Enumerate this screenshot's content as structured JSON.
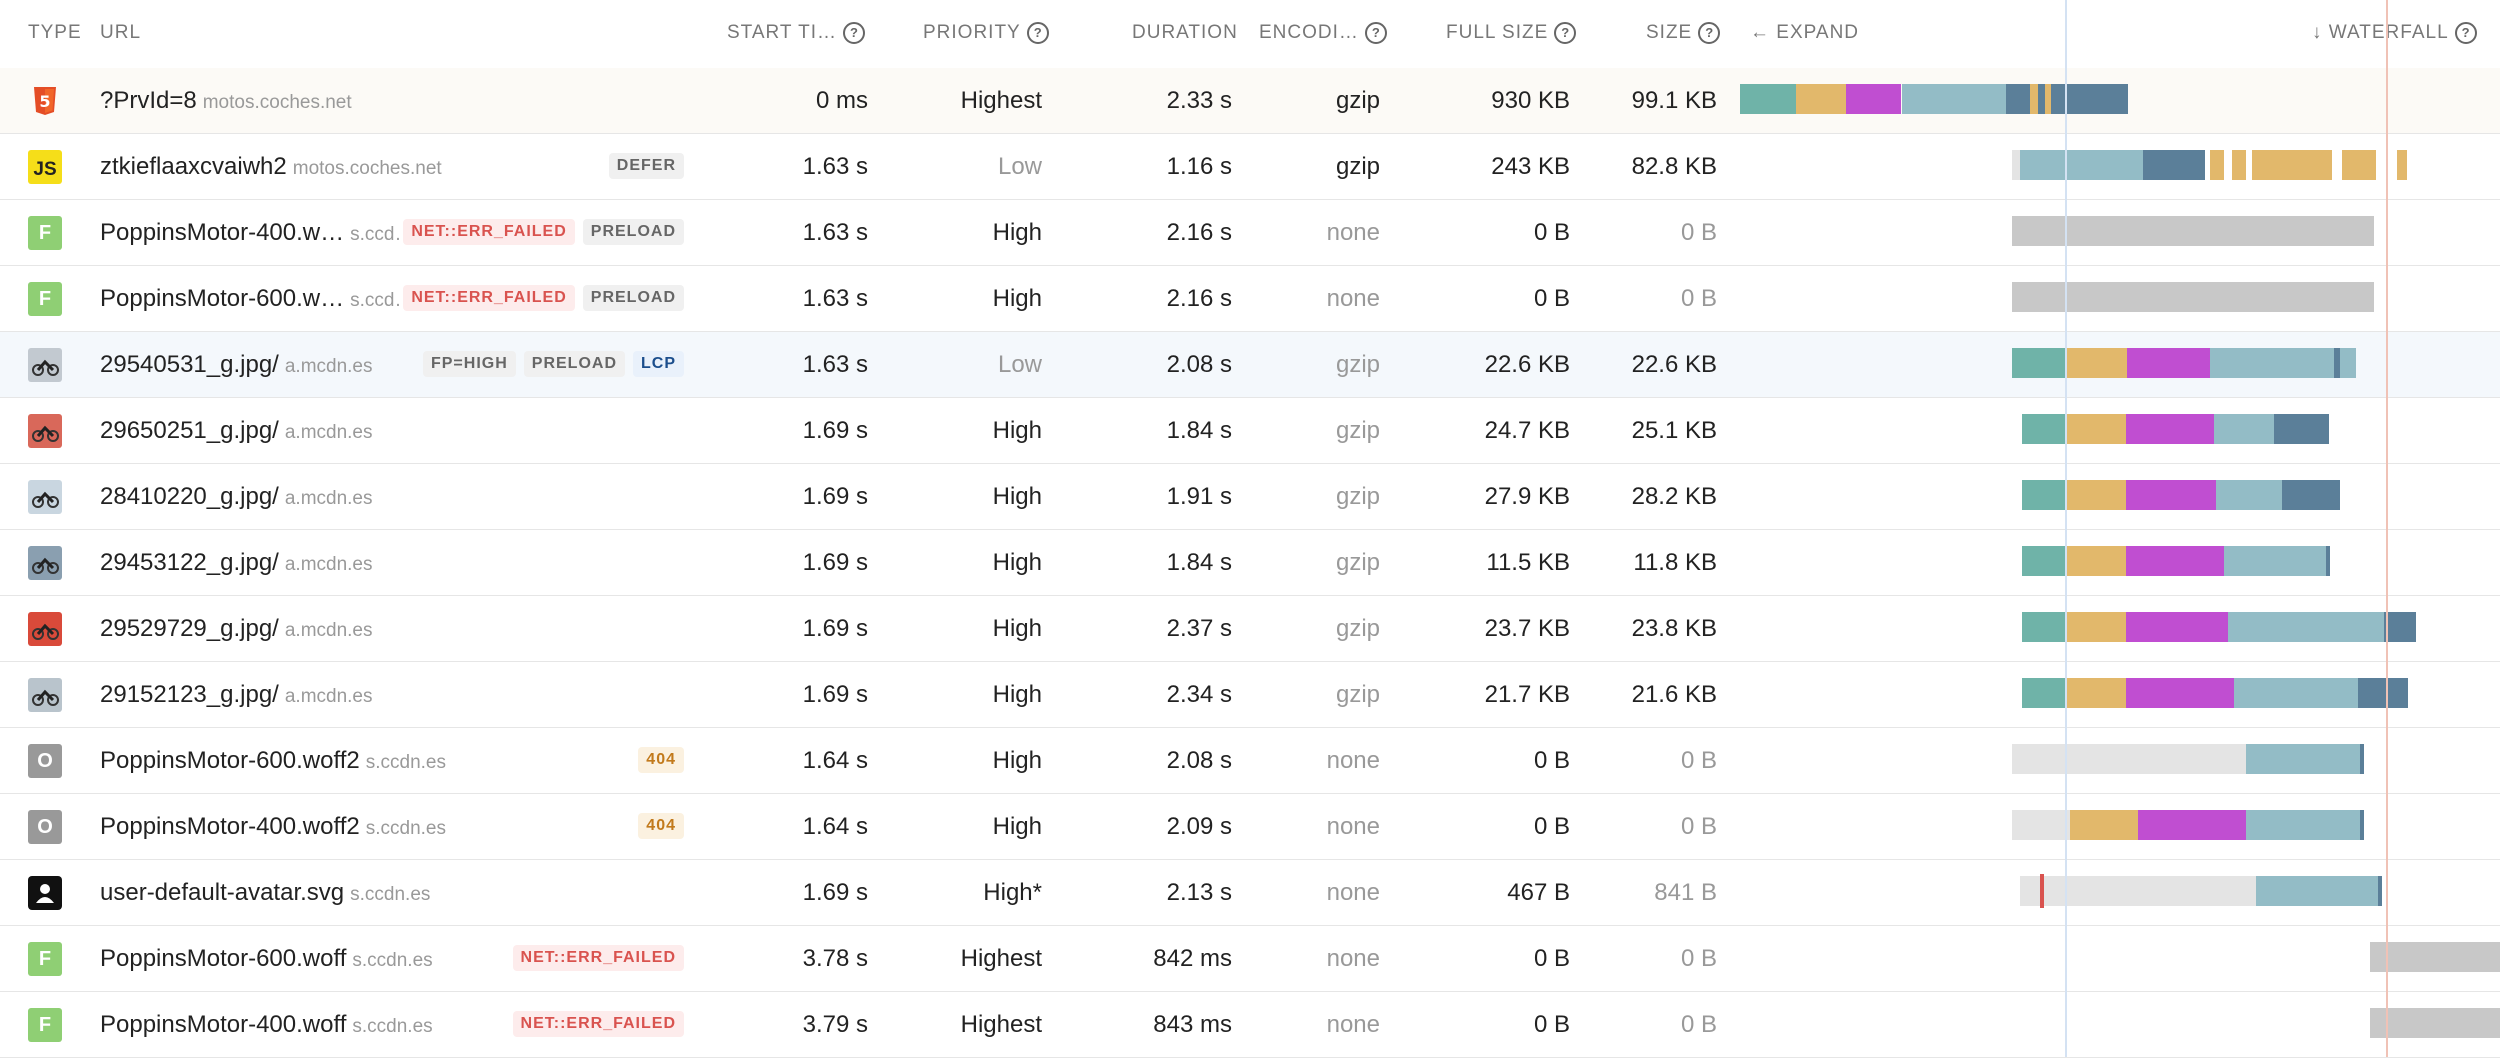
{
  "header": {
    "type": "TYPE",
    "url": "URL",
    "start_time": "START TI…",
    "priority": "PRIORITY",
    "duration": "DURATION",
    "encoding": "ENCODI…",
    "full_size": "FULL SIZE",
    "size": "SIZE",
    "expand": "EXPAND",
    "expand_arrow": "←",
    "waterfall": "WATERFALL",
    "waterfall_arrow": "↓",
    "help_glyph": "?"
  },
  "colors": {
    "teal_wait": "#6fb3a8",
    "orange_connect": "#e2b86b",
    "purple_ssl": "#c04ed1",
    "blue_download": "#93bcc6",
    "dark_blue": "#5b7f99",
    "grey_failed": "#c8c8c8",
    "light_grey_queue": "#e4e4e4",
    "lcp_line": "#e07a5f",
    "fcp_line": "#a9c4e8"
  },
  "rows": [
    {
      "type_icon": "html5-icon",
      "type_glyph": "5",
      "url": "?PrvId=8",
      "domain": "motos.coches.net",
      "badges": [],
      "start": "0 ms",
      "priority": "Highest",
      "priority_muted": false,
      "duration": "2.33 s",
      "encoding": "gzip",
      "encoding_muted": false,
      "full_size": "930 KB",
      "size": "99.1 KB",
      "size_muted": false
    },
    {
      "type_icon": "javascript-icon",
      "type_glyph": "JS",
      "url": "ztkieflaaxcvaiwh2",
      "domain": "motos.coches.net",
      "badges": [
        {
          "text": "DEFER",
          "kind": "plain"
        }
      ],
      "start": "1.63 s",
      "priority": "Low",
      "priority_muted": true,
      "duration": "1.16 s",
      "encoding": "gzip",
      "encoding_muted": false,
      "full_size": "243 KB",
      "size": "82.8 KB",
      "size_muted": false
    },
    {
      "type_icon": "font-icon",
      "type_glyph": "F",
      "url": "PoppinsMotor-400.w…",
      "domain": "s.ccd…",
      "badges": [
        {
          "text": "NET::ERR_FAILED",
          "kind": "err"
        },
        {
          "text": "PRELOAD",
          "kind": "plain"
        }
      ],
      "start": "1.63 s",
      "priority": "High",
      "priority_muted": false,
      "duration": "2.16 s",
      "encoding": "none",
      "encoding_muted": true,
      "full_size": "0 B",
      "size": "0 B",
      "size_muted": true
    },
    {
      "type_icon": "font-icon",
      "type_glyph": "F",
      "url": "PoppinsMotor-600.w…",
      "domain": "s.ccd…",
      "badges": [
        {
          "text": "NET::ERR_FAILED",
          "kind": "err"
        },
        {
          "text": "PRELOAD",
          "kind": "plain"
        }
      ],
      "start": "1.63 s",
      "priority": "High",
      "priority_muted": false,
      "duration": "2.16 s",
      "encoding": "none",
      "encoding_muted": true,
      "full_size": "0 B",
      "size": "0 B",
      "size_muted": true
    },
    {
      "type_icon": "image-thumbnail-icon",
      "type_glyph": "",
      "url": "29540531_g.jpg/",
      "domain": "a.mcdn.es",
      "badges": [
        {
          "text": "FP=HIGH",
          "kind": "plain"
        },
        {
          "text": "PRELOAD",
          "kind": "plain"
        },
        {
          "text": "LCP",
          "kind": "lcp"
        }
      ],
      "start": "1.63 s",
      "priority": "Low",
      "priority_muted": true,
      "duration": "2.08 s",
      "encoding": "gzip",
      "encoding_muted": true,
      "full_size": "22.6 KB",
      "size": "22.6 KB",
      "size_muted": false
    },
    {
      "type_icon": "image-thumbnail-icon",
      "type_glyph": "",
      "url": "29650251_g.jpg/",
      "domain": "a.mcdn.es",
      "badges": [],
      "start": "1.69 s",
      "priority": "High",
      "priority_muted": false,
      "duration": "1.84 s",
      "encoding": "gzip",
      "encoding_muted": true,
      "full_size": "24.7 KB",
      "size": "25.1 KB",
      "size_muted": false
    },
    {
      "type_icon": "image-thumbnail-icon",
      "type_glyph": "",
      "url": "28410220_g.jpg/",
      "domain": "a.mcdn.es",
      "badges": [],
      "start": "1.69 s",
      "priority": "High",
      "priority_muted": false,
      "duration": "1.91 s",
      "encoding": "gzip",
      "encoding_muted": true,
      "full_size": "27.9 KB",
      "size": "28.2 KB",
      "size_muted": false
    },
    {
      "type_icon": "image-thumbnail-icon",
      "type_glyph": "",
      "url": "29453122_g.jpg/",
      "domain": "a.mcdn.es",
      "badges": [],
      "start": "1.69 s",
      "priority": "High",
      "priority_muted": false,
      "duration": "1.84 s",
      "encoding": "gzip",
      "encoding_muted": true,
      "full_size": "11.5 KB",
      "size": "11.8 KB",
      "size_muted": false
    },
    {
      "type_icon": "image-thumbnail-icon",
      "type_glyph": "",
      "url": "29529729_g.jpg/",
      "domain": "a.mcdn.es",
      "badges": [],
      "start": "1.69 s",
      "priority": "High",
      "priority_muted": false,
      "duration": "2.37 s",
      "encoding": "gzip",
      "encoding_muted": true,
      "full_size": "23.7 KB",
      "size": "23.8 KB",
      "size_muted": false
    },
    {
      "type_icon": "image-thumbnail-icon",
      "type_glyph": "",
      "url": "29152123_g.jpg/",
      "domain": "a.mcdn.es",
      "badges": [],
      "start": "1.69 s",
      "priority": "High",
      "priority_muted": false,
      "duration": "2.34 s",
      "encoding": "gzip",
      "encoding_muted": true,
      "full_size": "21.7 KB",
      "size": "21.6 KB",
      "size_muted": false
    },
    {
      "type_icon": "other-file-icon",
      "type_glyph": "O",
      "url": "PoppinsMotor-600.woff2",
      "domain": "s.ccdn.es",
      "badges": [
        {
          "text": "404",
          "kind": "404"
        }
      ],
      "start": "1.64 s",
      "priority": "High",
      "priority_muted": false,
      "duration": "2.08 s",
      "encoding": "none",
      "encoding_muted": true,
      "full_size": "0 B",
      "size": "0 B",
      "size_muted": true
    },
    {
      "type_icon": "other-file-icon",
      "type_glyph": "O",
      "url": "PoppinsMotor-400.woff2",
      "domain": "s.ccdn.es",
      "badges": [
        {
          "text": "404",
          "kind": "404"
        }
      ],
      "start": "1.64 s",
      "priority": "High",
      "priority_muted": false,
      "duration": "2.09 s",
      "encoding": "none",
      "encoding_muted": true,
      "full_size": "0 B",
      "size": "0 B",
      "size_muted": true
    },
    {
      "type_icon": "avatar-icon",
      "type_glyph": "",
      "url": "user-default-avatar.svg",
      "domain": "s.ccdn.es",
      "badges": [],
      "start": "1.69 s",
      "priority": "High*",
      "priority_muted": false,
      "duration": "2.13 s",
      "encoding": "none",
      "encoding_muted": true,
      "full_size": "467 B",
      "size": "841 B",
      "size_muted": true
    },
    {
      "type_icon": "font-icon",
      "type_glyph": "F",
      "url": "PoppinsMotor-600.woff",
      "domain": "s.ccdn.es",
      "badges": [
        {
          "text": "NET::ERR_FAILED",
          "kind": "err"
        }
      ],
      "start": "3.78 s",
      "priority": "Highest",
      "priority_muted": false,
      "duration": "842 ms",
      "encoding": "none",
      "encoding_muted": true,
      "full_size": "0 B",
      "size": "0 B",
      "size_muted": true
    },
    {
      "type_icon": "font-icon",
      "type_glyph": "F",
      "url": "PoppinsMotor-400.woff",
      "domain": "s.ccdn.es",
      "badges": [
        {
          "text": "NET::ERR_FAILED",
          "kind": "err"
        }
      ],
      "start": "3.79 s",
      "priority": "Highest",
      "priority_muted": false,
      "duration": "843 ms",
      "encoding": "none",
      "encoding_muted": true,
      "full_size": "0 B",
      "size": "0 B",
      "size_muted": true
    }
  ]
}
